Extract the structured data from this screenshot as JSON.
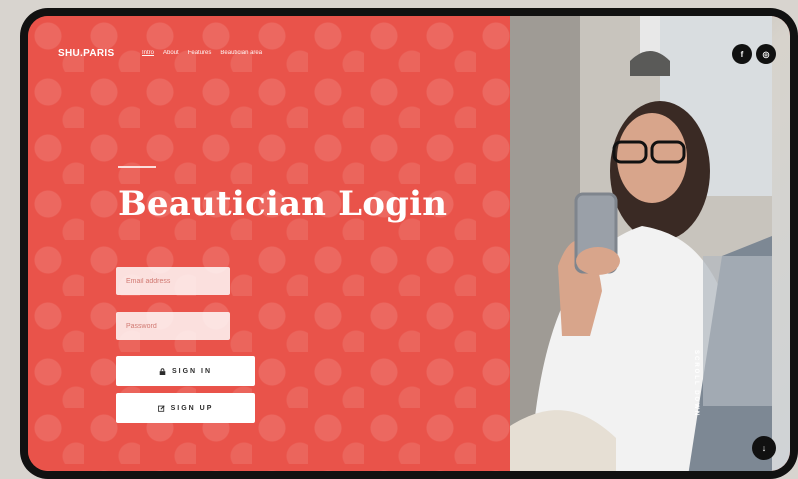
{
  "brand": {
    "logo": "SHU.PARIS"
  },
  "nav": {
    "items": [
      {
        "label": "Intro",
        "active": true
      },
      {
        "label": "About",
        "active": false
      },
      {
        "label": "Features",
        "active": false
      },
      {
        "label": "Beautician area",
        "active": false
      }
    ]
  },
  "hero": {
    "title": "Beautician Login"
  },
  "form": {
    "email_placeholder": "Email address",
    "password_placeholder": "Password",
    "signin_label": "SIGN IN",
    "signup_label": "SIGN UP"
  },
  "social": [
    {
      "icon": "facebook-icon",
      "glyph": "f"
    },
    {
      "icon": "instagram-icon",
      "glyph": "◎"
    }
  ],
  "scroll": {
    "label": "SCROLL DOWN",
    "icon": "arrow-down-icon"
  },
  "colors": {
    "brand": "#e9534a",
    "button_bg": "#ffffff",
    "dark": "#111111"
  }
}
